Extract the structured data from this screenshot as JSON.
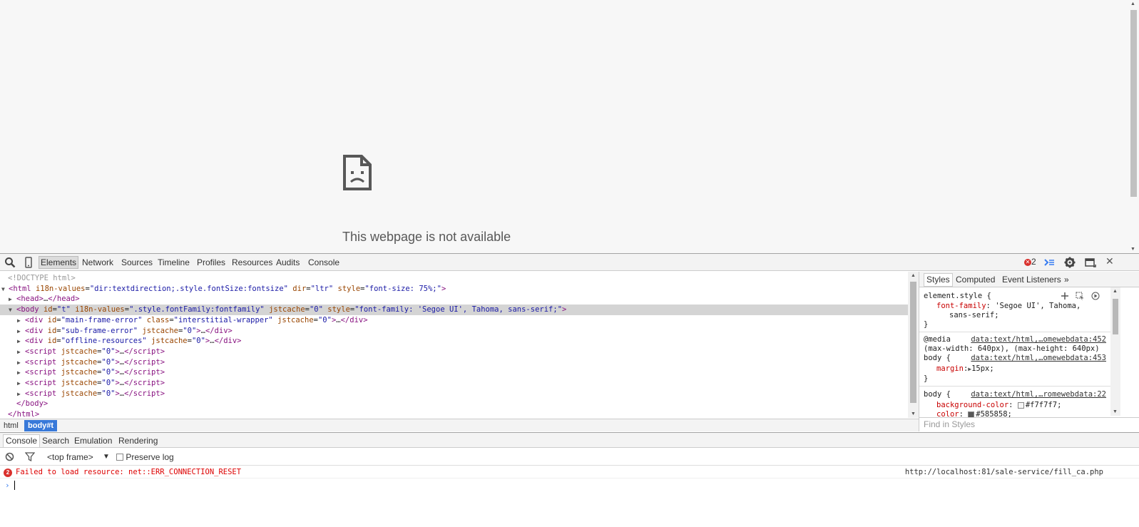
{
  "page": {
    "error_title": "This webpage is not available",
    "icon": "sad-page-icon"
  },
  "toolbar": {
    "search_icon": "magnifier-icon",
    "device_icon": "mobile-device-icon",
    "tabs": [
      "Elements",
      "Network",
      "Sources",
      "Timeline",
      "Profiles",
      "Resources",
      "Audits",
      "Console"
    ],
    "active_tab": "Elements",
    "error_count": "2",
    "drawer_icon": "console-drawer-icon",
    "settings_icon": "gear-icon",
    "dock_icon": "dock-side-icon",
    "close_icon": "close-icon"
  },
  "tree": {
    "doctype": "<!DOCTYPE html>",
    "html_open": {
      "tag": "html",
      "attrs": [
        {
          "name": "i18n-values",
          "value": "\"dir:textdirection;.style.fontSize:fontsize\""
        },
        {
          "name": "dir",
          "value": "\"ltr\""
        },
        {
          "name": "style",
          "value": "\"font-size: 75%;\""
        }
      ]
    },
    "head_line": "<head>…</head>",
    "body_open": {
      "tag": "body",
      "attrs": [
        {
          "name": "id",
          "value": "\"t\""
        },
        {
          "name": "i18n-values",
          "value": "\".style.fontFamily:fontfamily\""
        },
        {
          "name": "jstcache",
          "value": "\"0\""
        },
        {
          "name": "style",
          "value": "\"font-family: 'Segoe UI', Tahoma, sans-serif;\""
        }
      ]
    },
    "children": [
      {
        "tag": "div",
        "attrs": [
          {
            "name": "id",
            "value": "\"main-frame-error\""
          },
          {
            "name": "class",
            "value": "\"interstitial-wrapper\""
          },
          {
            "name": "jstcache",
            "value": "\"0\""
          }
        ],
        "close": "div"
      },
      {
        "tag": "div",
        "attrs": [
          {
            "name": "id",
            "value": "\"sub-frame-error\""
          },
          {
            "name": "jstcache",
            "value": "\"0\""
          }
        ],
        "close": "div"
      },
      {
        "tag": "div",
        "attrs": [
          {
            "name": "id",
            "value": "\"offline-resources\""
          },
          {
            "name": "jstcache",
            "value": "\"0\""
          }
        ],
        "close": "div"
      },
      {
        "tag": "script",
        "attrs": [
          {
            "name": "jstcache",
            "value": "\"0\""
          }
        ],
        "close": "script"
      },
      {
        "tag": "script",
        "attrs": [
          {
            "name": "jstcache",
            "value": "\"0\""
          }
        ],
        "close": "script"
      },
      {
        "tag": "script",
        "attrs": [
          {
            "name": "jstcache",
            "value": "\"0\""
          }
        ],
        "close": "script"
      },
      {
        "tag": "script",
        "attrs": [
          {
            "name": "jstcache",
            "value": "\"0\""
          }
        ],
        "close": "script"
      },
      {
        "tag": "script",
        "attrs": [
          {
            "name": "jstcache",
            "value": "\"0\""
          }
        ],
        "close": "script"
      }
    ],
    "body_close": "</body>",
    "html_close": "</html>"
  },
  "breadcrumbs": [
    "html",
    "body#t"
  ],
  "styles": {
    "tabs": [
      "Styles",
      "Computed",
      "Event Listeners",
      "»"
    ],
    "active_tab": "Styles",
    "element_style": {
      "selector": "element.style {",
      "prop": "font-family",
      "value_line1": "'Segoe UI', Tahoma,",
      "value_line2": "sans-serif;",
      "close": "}"
    },
    "media_rule": {
      "media": "@media",
      "source": "data:text/html,…omewebdata:452",
      "query": "(max-width: 640px), (max-height: 640px)",
      "selector": "body {",
      "source2": "data:text/html,…omewebdata:453",
      "prop": "margin",
      "value": "15px;",
      "close": "}"
    },
    "body_rule": {
      "selector": "body {",
      "source": "data:text/html,…romewebdata:22",
      "prop1": "background-color",
      "value1": "#f7f7f7;",
      "swatch1": "#f7f7f7",
      "prop2": "color",
      "value2": "#585858;",
      "swatch2": "#585858"
    },
    "find_placeholder": "Find in Styles"
  },
  "drawer": {
    "tabs": [
      "Console",
      "Search",
      "Emulation",
      "Rendering"
    ],
    "active_tab": "Console",
    "frame_select": "<top frame>",
    "preserve_log": "Preserve log"
  },
  "console": {
    "error_count": "2",
    "error_message": "Failed to load resource: net::ERR_CONNECTION_RESET",
    "error_source": "http://localhost:81/sale-service/fill_ca.php",
    "prompt": "›"
  }
}
